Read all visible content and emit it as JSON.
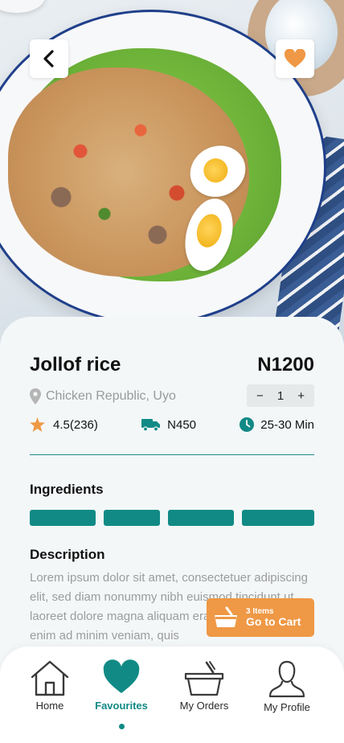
{
  "product": {
    "name": "Jollof rice",
    "price": "N1200",
    "location": "Chicken Republic, Uyo",
    "quantity": "1",
    "decrement_symbol": "−",
    "increment_symbol": "+",
    "rating": "4.5(236)",
    "delivery_fee": "N450",
    "delivery_time": "25-30 Min"
  },
  "sections": {
    "ingredients_title": "Ingredients",
    "description_title": "Description",
    "description_text": "Lorem ipsum dolor sit amet, consectetuer adipiscing elit, sed diam nonummy nibh euismod tincidunt ut laoreet dolore magna aliquam erat volutpat. Ut wisi enim ad minim veniam, quis"
  },
  "ingredients_count": 4,
  "cart": {
    "items_label": "3 Items",
    "button_label": "Go to Cart"
  },
  "nav": {
    "items": [
      {
        "label": "Home",
        "icon": "home-icon",
        "active": false
      },
      {
        "label": "Favourites",
        "icon": "heart-icon",
        "active": true
      },
      {
        "label": "My Orders",
        "icon": "basket-icon",
        "active": false
      },
      {
        "label": "My Profile",
        "icon": "person-icon",
        "active": false
      }
    ]
  },
  "icons": {
    "back": "chevron-left-icon",
    "favorite": "heart-icon",
    "location": "map-pin-icon",
    "rating": "star-icon",
    "delivery": "truck-icon",
    "time": "clock-icon",
    "cart": "basket-icon"
  },
  "colors": {
    "primary_teal": "#118a86",
    "accent_orange": "#ef9845",
    "star_orange": "#ef9845",
    "muted_text": "#9c9c9c",
    "sheet_bg": "#f3f7f8"
  }
}
